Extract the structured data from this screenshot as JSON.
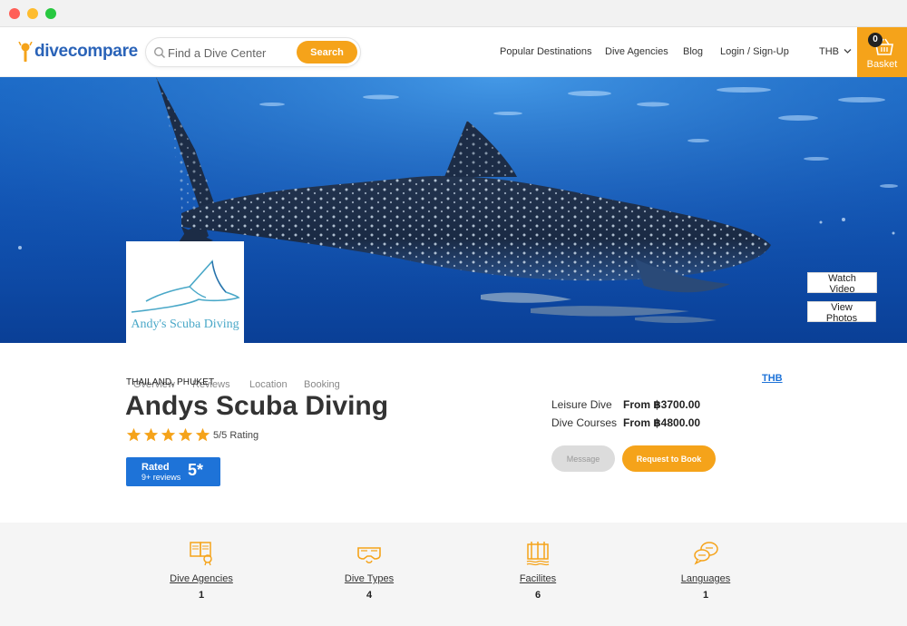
{
  "header": {
    "logo": {
      "dive": "dive",
      "compare": "compare"
    },
    "search": {
      "placeholder": "Find a Dive Center",
      "button": "Search"
    },
    "nav": [
      "Popular Destinations",
      "Dive Agencies",
      "Blog",
      "Login / Sign-Up"
    ],
    "currency": "THB",
    "basket": {
      "count": "0",
      "label": "Basket"
    }
  },
  "hero": {
    "watch_video": "Watch Video",
    "view_photos": "View Photos",
    "center_logo_text": "Andy's Scuba Diving"
  },
  "tabs": [
    "Overview",
    "Reviews",
    "Location",
    "Booking"
  ],
  "center": {
    "location": "THAILAND, PHUKET",
    "name": "Andys Scuba Diving",
    "rating_text": "5/5 Rating",
    "stars": 5,
    "rated_label": "Rated",
    "rated_reviews": "9+ reviews",
    "rated_score": "5*"
  },
  "pricing": {
    "currency_link": "THB",
    "rows": [
      {
        "label": "Leisure Dive",
        "value": "From ฿3700.00"
      },
      {
        "label": "Dive Courses",
        "value": "From ฿4800.00"
      }
    ],
    "message_button": "Message",
    "book_button": "Request to Book"
  },
  "features": [
    {
      "label": "Dive Agencies",
      "count": "1",
      "icon": "agencies-icon"
    },
    {
      "label": "Dive Types",
      "count": "4",
      "icon": "dive-mask-icon"
    },
    {
      "label": "Facilites",
      "count": "6",
      "icon": "facilities-icon"
    },
    {
      "label": "Languages",
      "count": "1",
      "icon": "languages-icon"
    }
  ],
  "colors": {
    "accent": "#f5a31a",
    "brand_blue": "#1e73d8"
  }
}
